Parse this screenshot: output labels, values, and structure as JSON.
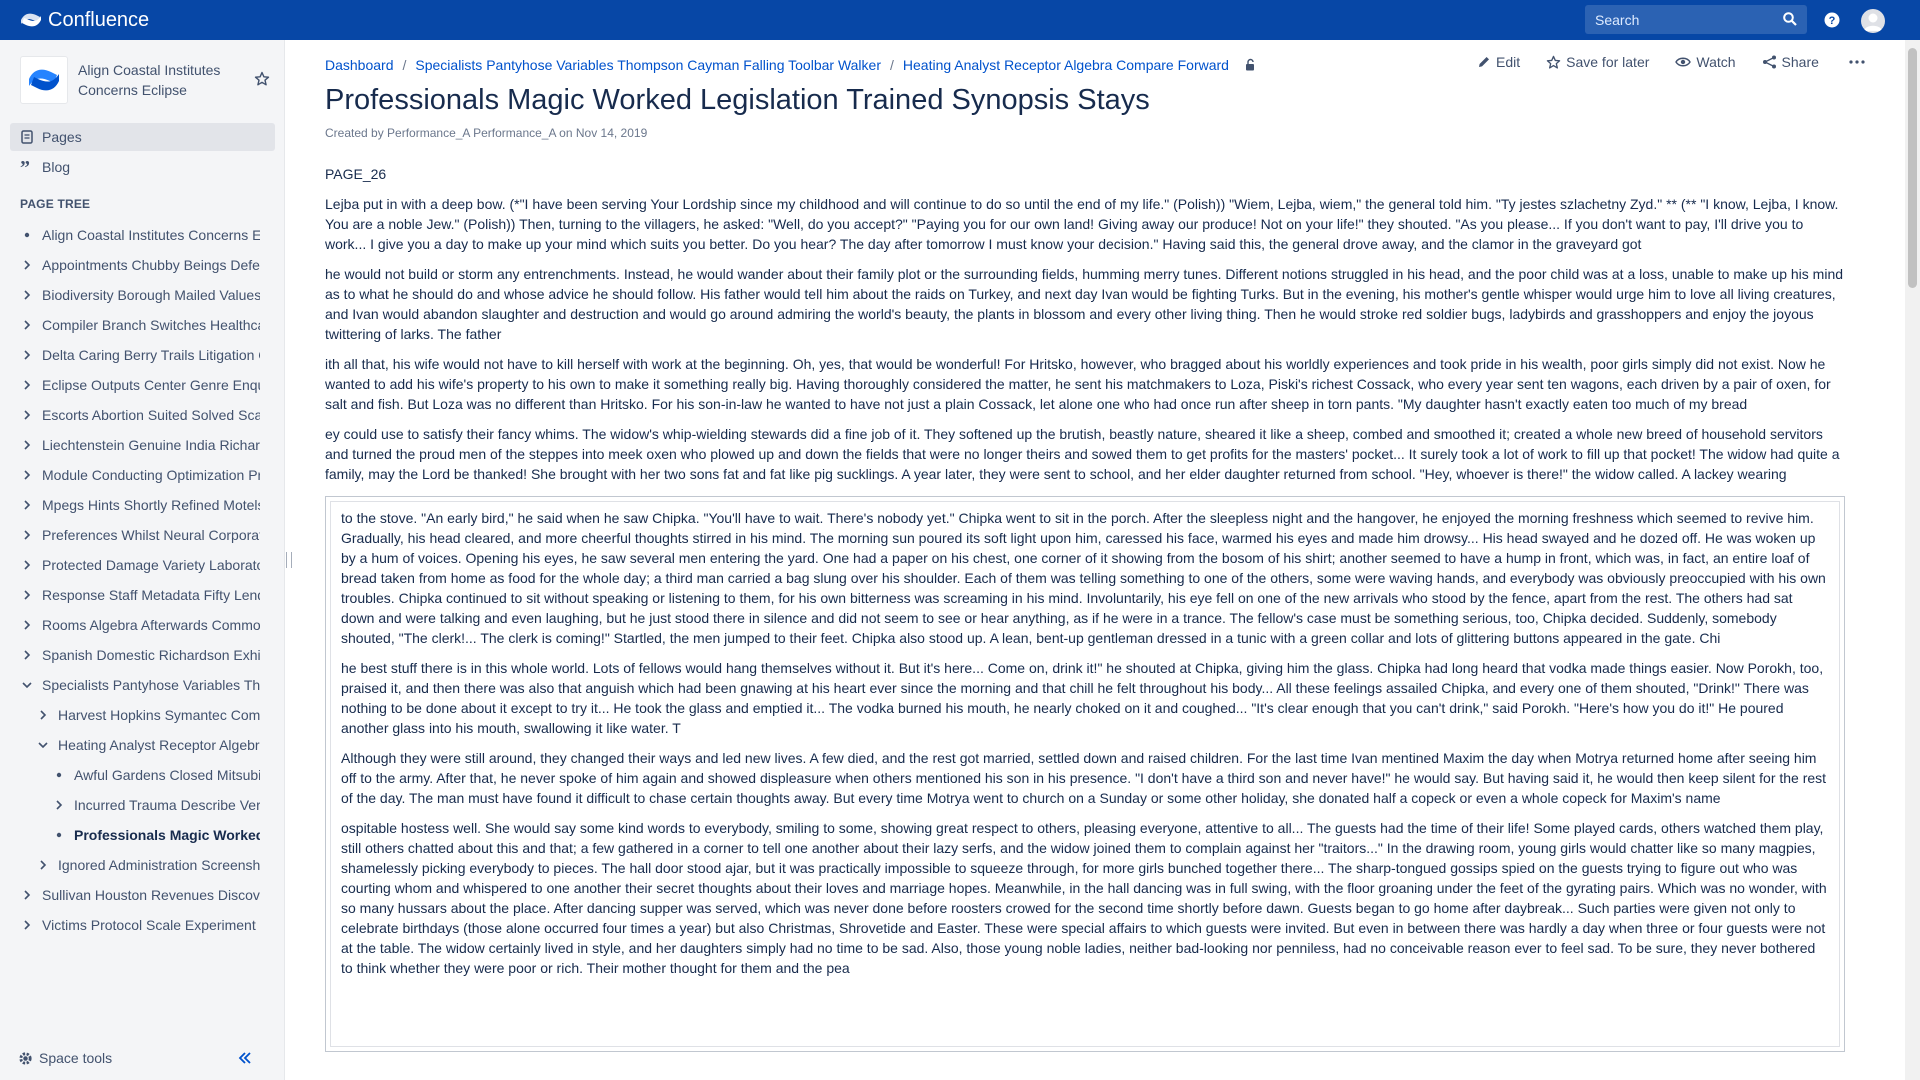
{
  "app": {
    "name": "Confluence"
  },
  "search": {
    "placeholder": "Search"
  },
  "space": {
    "name": "Align Coastal Institutes Concerns Eclipse"
  },
  "nav": {
    "pages": "Pages",
    "blog": "Blog"
  },
  "page_tree": {
    "label": "PAGE TREE",
    "items": [
      {
        "label": "Align Coastal Institutes Concerns Eclipse",
        "toggle": "bullet"
      },
      {
        "label": "Appointments Chubby Beings Defend",
        "toggle": "right"
      },
      {
        "label": "Biodiversity Borough Mailed Values",
        "toggle": "right"
      },
      {
        "label": "Compiler Branch Switches Healthcare",
        "toggle": "right"
      },
      {
        "label": "Delta Caring Berry Trails Litigation Co",
        "toggle": "right"
      },
      {
        "label": "Eclipse Outputs Center Genre Enquiry",
        "toggle": "right"
      },
      {
        "label": "Escorts Abortion Suited Solved Scan",
        "toggle": "right"
      },
      {
        "label": "Liechtenstein Genuine India Richards",
        "toggle": "right"
      },
      {
        "label": "Module Conducting Optimization Pro",
        "toggle": "right"
      },
      {
        "label": "Mpegs Hints Shortly Refined Motels",
        "toggle": "right"
      },
      {
        "label": "Preferences Whilst Neural Corporate",
        "toggle": "right"
      },
      {
        "label": "Protected Damage Variety Laboratory",
        "toggle": "right"
      },
      {
        "label": "Response Staff Metadata Fifty Lender",
        "toggle": "right"
      },
      {
        "label": "Rooms Algebra Afterwards Common",
        "toggle": "right"
      },
      {
        "label": "Spanish Domestic Richardson Exhibit",
        "toggle": "right"
      },
      {
        "label": "Specialists Pantyhose Variables Thompson",
        "toggle": "down"
      },
      {
        "label": "Harvest Hopkins Symantec Community",
        "toggle": "right",
        "indent": 1
      },
      {
        "label": "Heating Analyst Receptor Algebra",
        "toggle": "down",
        "indent": 1
      },
      {
        "label": "Awful Gardens Closed Mitsubishi",
        "toggle": "bullet",
        "indent": 2
      },
      {
        "label": "Incurred Trauma Describe Version",
        "toggle": "right",
        "indent": 2
      },
      {
        "label": "Professionals Magic Worked",
        "toggle": "bullet",
        "indent": 2,
        "current": true
      },
      {
        "label": "Ignored Administration Screenshot",
        "toggle": "right",
        "indent": 1
      },
      {
        "label": "Sullivan Houston Revenues Discovered",
        "toggle": "right"
      },
      {
        "label": "Victims Protocol Scale Experiment S",
        "toggle": "right"
      }
    ]
  },
  "space_tools": "Space tools",
  "breadcrumbs": [
    "Dashboard",
    "Specialists Pantyhose Variables Thompson Cayman Falling Toolbar Walker",
    "Heating Analyst Receptor Algebra Compare Forward"
  ],
  "actions": {
    "edit": "Edit",
    "save": "Save for later",
    "watch": "Watch",
    "share": "Share"
  },
  "page": {
    "title": "Professionals Magic Worked Legislation Trained Synopsis Stays",
    "byline_prefix": "Created by",
    "author": "Performance_A Performance_A",
    "byline_on": "on",
    "date": "Nov 14, 2019",
    "paragraphs": [
      "PAGE_26",
      "Lejba put in with a deep bow. (*\"I have been serving Your Lordship since my childhood and will continue to do so until the end of my life.\" (Polish)) \"Wiem, Lejba, wiem,\" the general told him. \"Ty jestes szlachetny Zyd.\" ** (** \"I know, Lejba, I know. You are a noble Jew.\" (Polish)) Then, turning to the villagers, he asked: \"Well, do you accept?\" \"Paying you for our own land! Giving away our produce! Not on your life!\" they shouted. \"As you please... If you don't want to pay, I'll drive you to work... I give you a day to make up your mind which suits you better. Do you hear? The day after tomorrow I must know your decision.\" Having said this, the general drove away, and the clamor in the graveyard got",
      "he would not build or storm any entrenchments. Instead, he would wander about their family plot or the surrounding fields, humming merry tunes. Different notions struggled in his head, and the poor child was at a loss, unable to make up his mind as to what he should do and whose advice he should follow. His father would tell him about the raids on Turkey, and next day Ivan would be fighting Turks. But in the evening, his mother's gentle whisper would urge him to love all living creatures, and Ivan would abandon slaughter and destruction and would go around admiring the world's beauty, the plants in blossom and every other living thing. Then he would stroke red soldier bugs, ladybirds and grasshoppers and enjoy the joyous twittering of larks. The father",
      "ith all that, his wife would not have to kill herself with work at the beginning. Oh, yes, that would be wonderful! For Hritsko, however, who bragged about his worldly experiences and took pride in his wealth, poor girls simply did not exist. Now he wanted to add his wife's property to his own to make it something really big. Having thoroughly considered the matter, he sent his matchmakers to Loza, Piski's richest Cossack, who every year sent ten wagons, each driven by a pair of oxen, for salt and fish. But Loza was no different than Hritsko. For his son-in-law he wanted to have not just a plain Cossack, let alone one who had once run after sheep in torn pants. \"My daughter hasn't exactly eaten too much of my bread",
      "ey could use to satisfy their fancy whims. The widow's whip-wielding stewards did a fine job of it. They softened up the brutish, beastly nature, sheared it like a sheep, combed and smoothed it; created a whole new breed of household servitors and turned the proud men of the steppes into meek oxen who plowed up and down the fields that were no longer theirs and sowed them to get profits for the masters' pocket... It surely took a lot of work to fill up that pocket! The widow had quite a family, may the Lord be thanked! She brought with her two sons fat and fat like pig sucklings. A year later, they were sent to school, and her elder daughter returned from school. \"Hey, whoever is there!\" the widow called. A lackey wearing"
    ],
    "panel_paragraphs": [
      "to the stove. \"An early bird,\" he said when he saw Chipka. \"You'll have to wait. There's nobody yet.\" Chipka went to sit in the porch. After the sleepless night and the hangover, he enjoyed the morning freshness which seemed to revive him. Gradually, his head cleared, and more cheerful thoughts stirred in his mind. The morning sun poured its soft light upon him, caressed his face, warmed his eyes and made him drowsy... His head swayed and he dozed off. He was woken up by a hum of voices. Opening his eyes, he saw several men entering the yard. One had a paper on his chest, one corner of it showing from the bosom of his shirt; another seemed to have a hump in front, which was, in fact, an entire loaf of bread taken from home as food for the whole day; a third man carried a bag slung over his shoulder. Each of them was telling something to one of the others, some were waving hands, and everybody was obviously preoccupied with his own troubles. Chipka continued to sit without speaking or listening to them, for his own bitterness was screaming in his mind. Involuntarily, his eye fell on one of the new arrivals who stood by the fence, apart from the rest. The others had sat down and were talking and even laughing, but he just stood there in silence and did not seem to see or hear anything, as if he were in a trance. The fellow's case must be something serious, too, Chipka decided. Suddenly, somebody shouted, \"The clerk!... The clerk is coming!\" Startled, the men jumped to their feet. Chipka also stood up. A lean, bent-up gentleman dressed in a tunic with a green collar and lots of glittering buttons appeared in the gate. Chi",
      "he best stuff there is in this whole world. Lots of fellows would hang themselves without it. But it's here... Come on, drink it!\" he shouted at Chipka, giving him the glass. Chipka had long heard that vodka made things easier. Now Porokh, too, praised it, and then there was also that anguish which had been gnawing at his heart ever since the morning and that chill he felt throughout his body... All these feelings assailed Chipka, and every one of them shouted, \"Drink!\" There was nothing to be done about it except to try it... He took the glass and emptied it... The vodka burned his mouth, he nearly choked on it and coughed... \"It's clear enough that you can't drink,\" said Porokh. \"Here's how you do it!\" He poured another glass into his mouth, swallowing it like water. T",
      "Although they were still around, they changed their ways and led new lives. A few died, and the rest got married, settled down and raised children. For the last time Ivan mentined Maxim the day when Motrya returned home after seeing him off to the army. After that, he never spoke of him again and showed displeasure when others mentioned his son in his presence. \"I don't have a third son and never have!\" he would say. But having said it, he would then keep silent for the rest of the day. The man must have found it difficult to chase certain thoughts away. But every time Motrya went to church on a Sunday or some other holiday, she donated half a copeck or even a whole copeck for Maxim's name",
      "ospitable hostess well. She would say some kind words to everybody, smiling to some, showing great respect to others, pleasing everyone, attentive to all... The guests had the time of their life! Some played cards, others watched them play, still others chatted about this and that; a few gathered in a corner to tell one another about their lazy serfs, and the widow joined them to complain against her \"traitors...\" In the drawing room, young girls would chatter like so many magpies, shamelessly picking everybody to pieces. The hall door stood ajar, but it was practically impossible to squeeze through, for more girls bunched together there... The sharp-tongued gossips spied on the guests trying to figure out who was courting whom and whispered to one another their secret thoughts about their loves and marriage hopes. Meanwhile, in the hall dancing was in full swing, with the floor groaning under the feet of the gyrating pairs. Which was no wonder, with so many hussars about the place. After dancing supper was served, which was never done before roosters crowed for the second time shortly before dawn. Guests began to go home after daybreak... Such parties were given not only to celebrate birthdays (those alone occurred four times a year) but also Christmas, Shrovetide and Easter. These were special affairs to which guests were invited. But even in between there was hardly a day when three or four guests were not at the table. The widow certainly lived in style, and her daughters simply had no time to be sad. Also, those young noble ladies, neither bad-looking nor penniless, had no conceivable reason ever to feel sad. To be sure, they never bothered to think whether they were poor or rich. Their mother thought for them and the pea"
    ]
  },
  "colors": {
    "topbar": "#0747a6",
    "link": "#0052cc",
    "sidebar": "#f4f5f7"
  }
}
